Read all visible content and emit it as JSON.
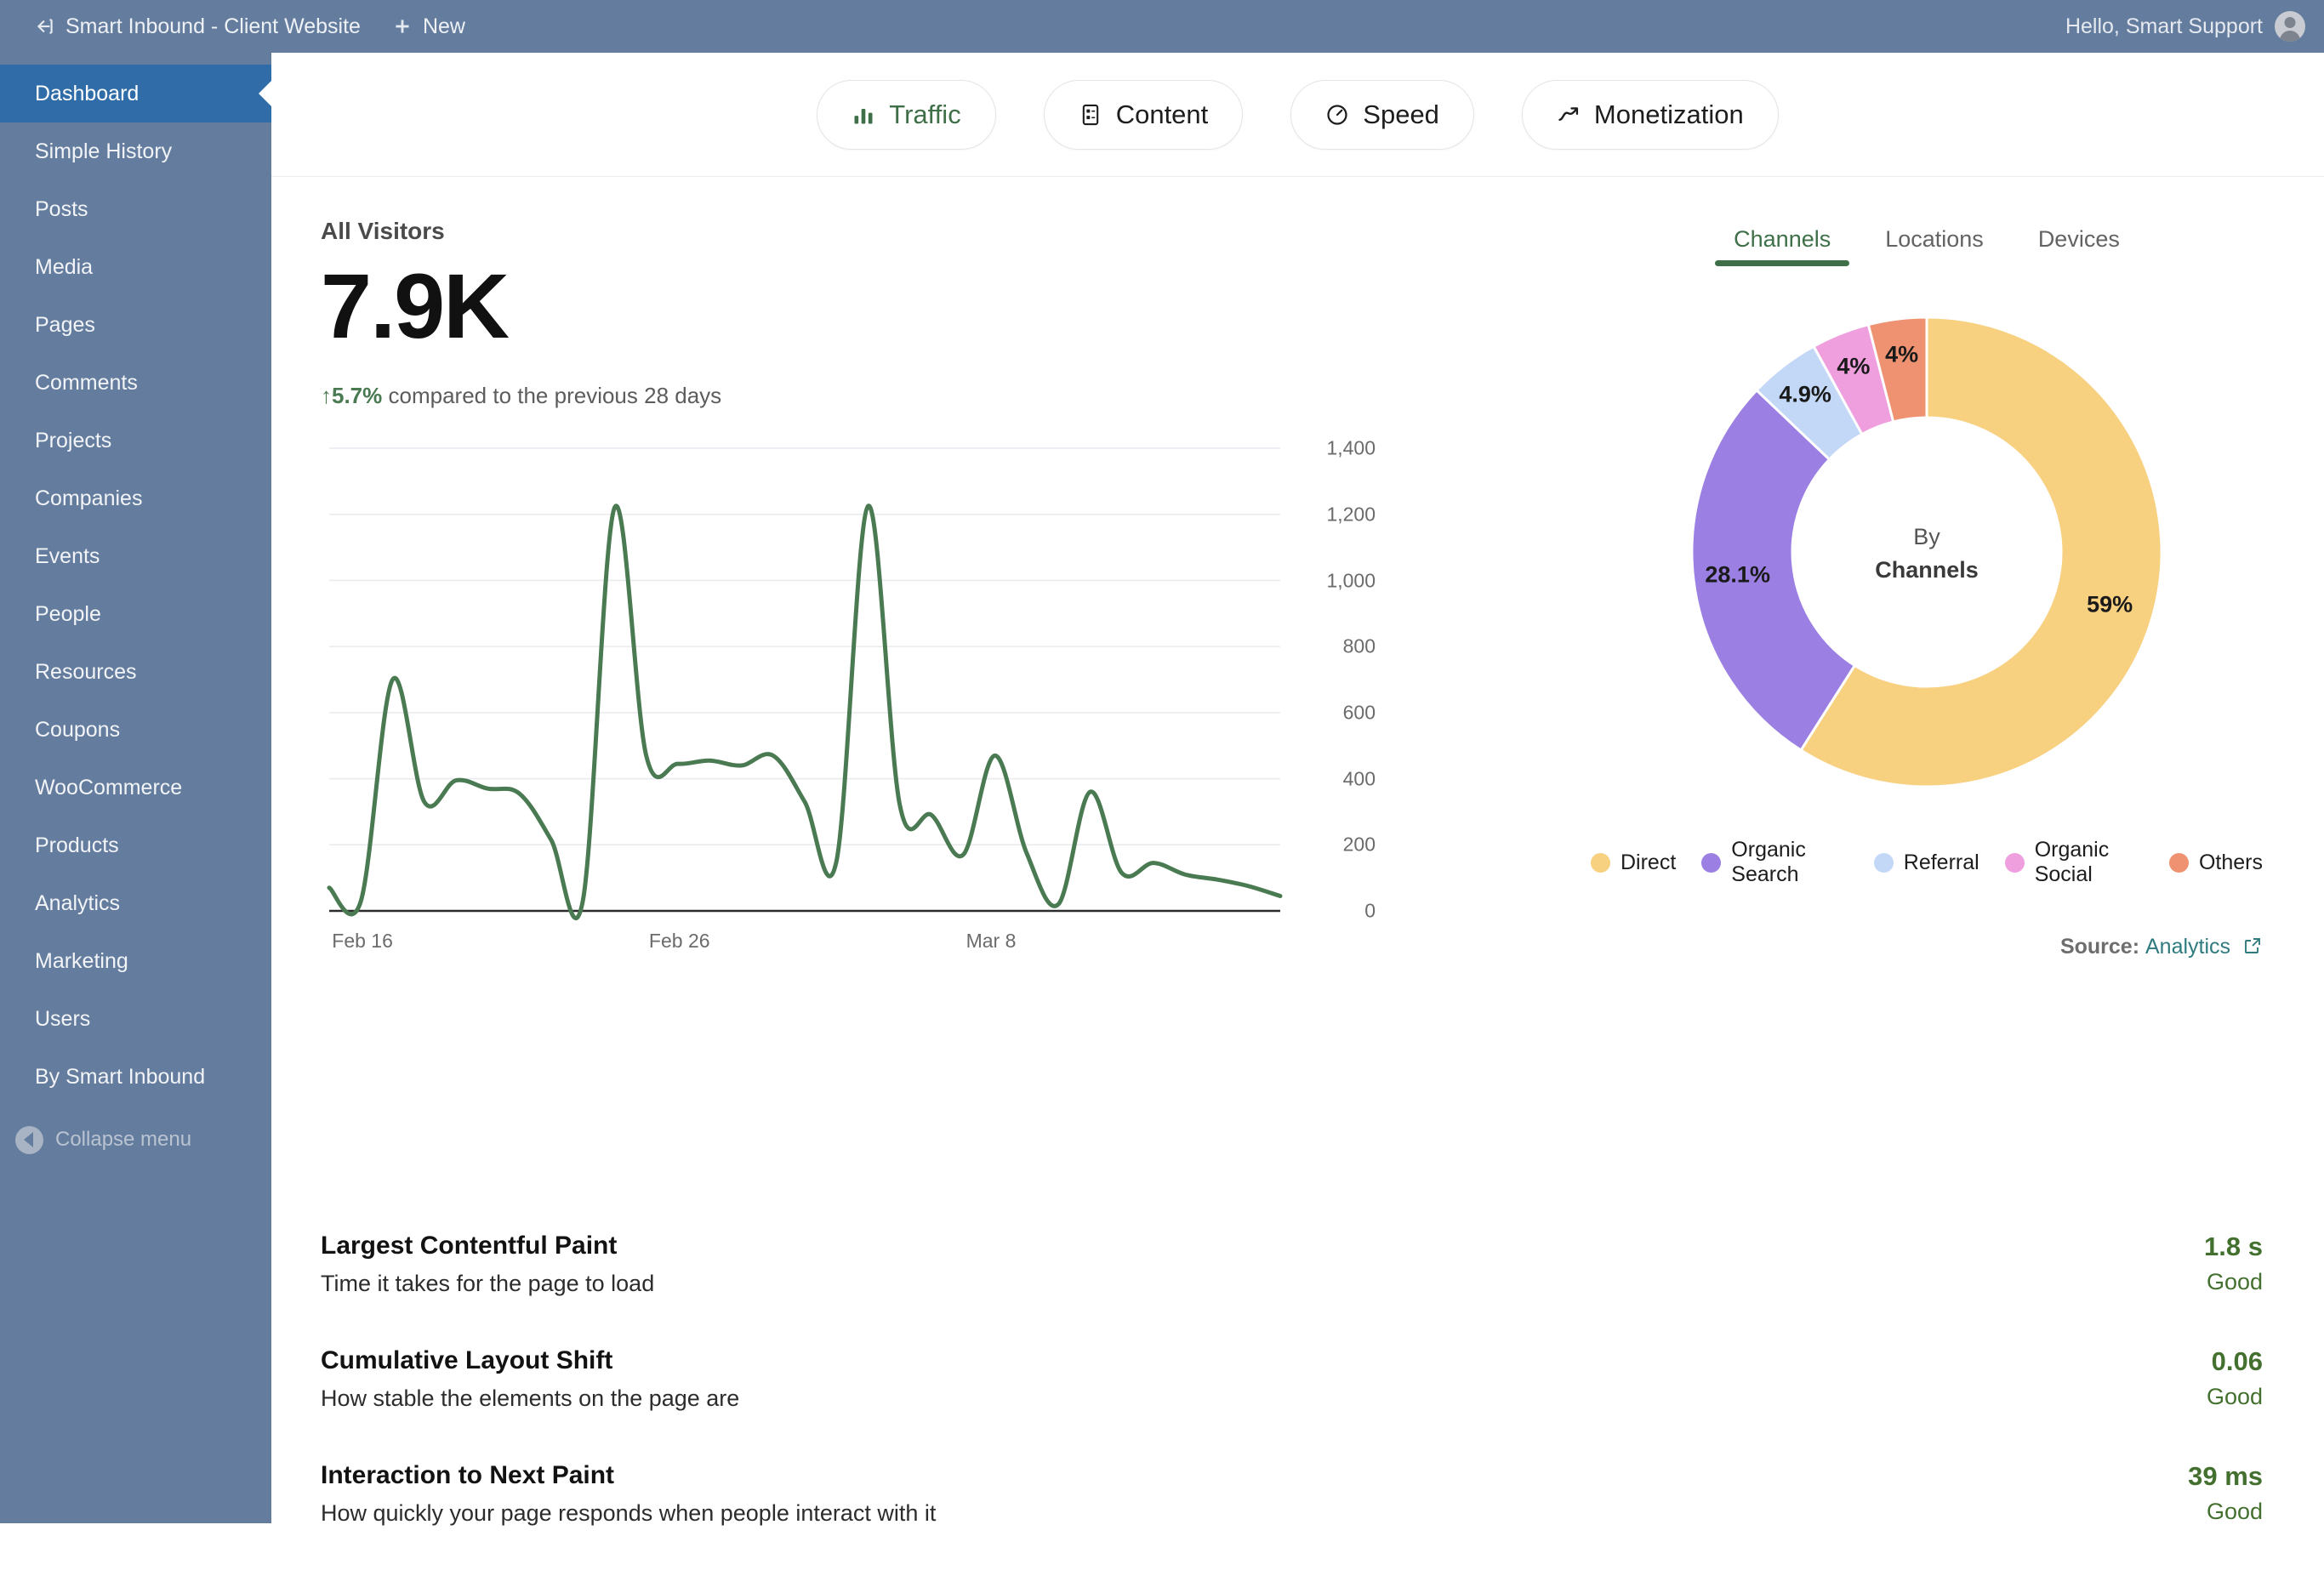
{
  "adminbar": {
    "back_icon": "back-arrow-icon",
    "site_title": "Smart Inbound - Client Website",
    "new_icon": "plus-icon",
    "new_label": "New",
    "greeting": "Hello, Smart Support"
  },
  "sidebar": {
    "items": [
      {
        "label": "Dashboard",
        "active": true
      },
      {
        "label": "Simple History",
        "active": false
      },
      {
        "label": "Posts",
        "active": false
      },
      {
        "label": "Media",
        "active": false
      },
      {
        "label": "Pages",
        "active": false
      },
      {
        "label": "Comments",
        "active": false
      },
      {
        "label": "Projects",
        "active": false
      },
      {
        "label": "Companies",
        "active": false
      },
      {
        "label": "Events",
        "active": false
      },
      {
        "label": "People",
        "active": false
      },
      {
        "label": "Resources",
        "active": false
      },
      {
        "label": "Coupons",
        "active": false
      },
      {
        "label": "WooCommerce",
        "active": false
      },
      {
        "label": "Products",
        "active": false
      },
      {
        "label": "Analytics",
        "active": false
      },
      {
        "label": "Marketing",
        "active": false
      },
      {
        "label": "Users",
        "active": false
      },
      {
        "label": "By Smart Inbound",
        "active": false
      }
    ],
    "collapse_label": "Collapse menu",
    "collapse_icon": "chevron-left-circle-icon"
  },
  "tabs": [
    {
      "label": "Traffic",
      "icon": "bar-chart-icon",
      "active": true
    },
    {
      "label": "Content",
      "icon": "content-layout-icon",
      "active": false
    },
    {
      "label": "Speed",
      "icon": "gauge-icon",
      "active": false
    },
    {
      "label": "Monetization",
      "icon": "trend-up-arrow-icon",
      "active": false
    }
  ],
  "summary": {
    "label": "All Visitors",
    "value": "7.9K",
    "delta_arrow": "↑",
    "delta": "5.7%",
    "delta_text": "compared to the previous 28 days"
  },
  "segment_tabs": [
    {
      "label": "Channels",
      "active": true
    },
    {
      "label": "Locations",
      "active": false
    },
    {
      "label": "Devices",
      "active": false
    }
  ],
  "donut_center": {
    "line1": "By",
    "line2": "Channels"
  },
  "source": {
    "prefix": "Source:",
    "link": "Analytics",
    "icon": "external-link-icon"
  },
  "metrics": [
    {
      "title": "Largest Contentful Paint",
      "desc": "Time it takes for the page to load",
      "value": "1.8 s",
      "status": "Good"
    },
    {
      "title": "Cumulative Layout Shift",
      "desc": "How stable the elements on the page are",
      "value": "0.06",
      "status": "Good"
    },
    {
      "title": "Interaction to Next Paint",
      "desc": "How quickly your page responds when people interact with it",
      "value": "39 ms",
      "status": "Good"
    }
  ],
  "colors": {
    "sidebar": "#647d9e",
    "active_menu": "#2f6ca8",
    "line_green": "#4a7a52",
    "accent_green": "#3f6f48",
    "good_green": "#43702f",
    "link_teal": "#2f7a7f"
  },
  "chart_data": [
    {
      "type": "line",
      "title": "All Visitors",
      "xlabel": "",
      "ylabel": "",
      "ylim": [
        0,
        1400
      ],
      "yticks": [
        "0",
        "200",
        "400",
        "600",
        "800",
        "1,000",
        "1,200",
        "1,400"
      ],
      "ytick_values": [
        0,
        200,
        400,
        600,
        800,
        1000,
        1200,
        1400
      ],
      "xticks": [
        "Feb 16",
        "Feb 26",
        "Mar 8"
      ],
      "xtick_indices": [
        1,
        11,
        21
      ],
      "grid": true,
      "legend": "none",
      "series": [
        {
          "name": "Visitors",
          "color": "#4a7a52",
          "values": [
            70,
            30,
            700,
            330,
            395,
            370,
            355,
            215,
            30,
            1220,
            470,
            445,
            455,
            440,
            470,
            330,
            150,
            1225,
            320,
            290,
            170,
            470,
            175,
            20,
            360,
            115,
            145,
            110,
            95,
            75,
            45
          ]
        }
      ]
    },
    {
      "type": "pie",
      "subtype": "donut",
      "title": "By Channels",
      "legend": "bottom",
      "labels": [
        "Direct",
        "Organic Search",
        "Referral",
        "Organic Social",
        "Others"
      ],
      "values": [
        59,
        28.1,
        4.9,
        4,
        4
      ],
      "display_values": [
        "59%",
        "28.1%",
        "4.9%",
        "4%",
        "4%"
      ],
      "colors": [
        "#f7d080",
        "#9b7fe3",
        "#c3d7f7",
        "#ef9ede",
        "#ef9272"
      ]
    }
  ]
}
